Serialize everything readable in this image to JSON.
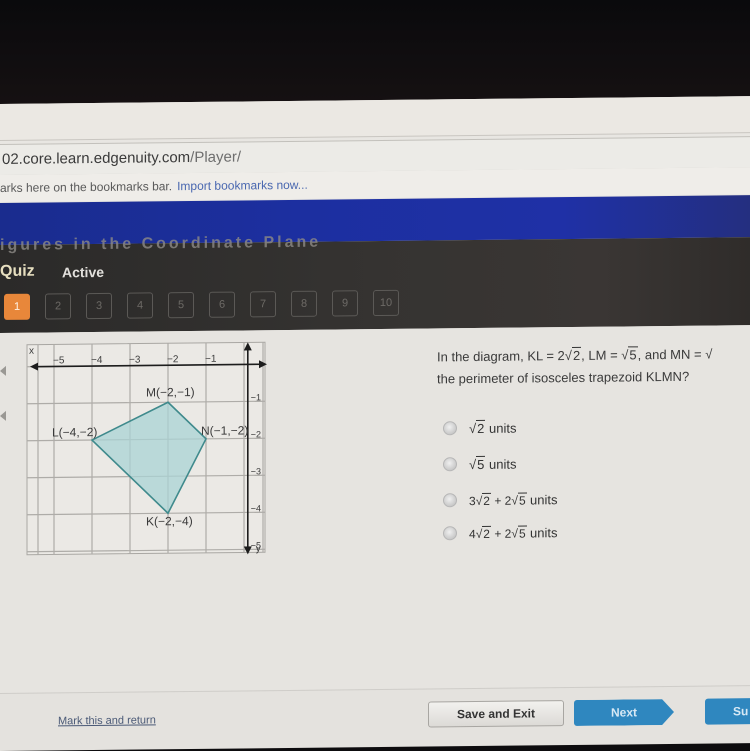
{
  "browser": {
    "address": "02.core.learn.edgenuity.com",
    "address_path": "/Player/",
    "bookmarks_text": "arks here on the bookmarks bar.",
    "bookmarks_link": "Import bookmarks now..."
  },
  "quiz": {
    "partial_title": "igures in the Coordinate Plane",
    "label": "Quiz",
    "status": "Active",
    "questions": [
      "1",
      "2",
      "3",
      "4",
      "5",
      "6",
      "7",
      "8",
      "9",
      "10"
    ],
    "active_question": "1",
    "accent_color": "#e8873a"
  },
  "graph": {
    "x_axis_label": "x",
    "y_axis_label": "y",
    "x_ticks": [
      "-5",
      "-4",
      "-3",
      "-2",
      "-1"
    ],
    "y_ticks": [
      "-1",
      "-2",
      "-3",
      "-4",
      "-5"
    ],
    "points": [
      {
        "label": "M(-2,-1)",
        "x": -2,
        "y": -1
      },
      {
        "label": "L(-4,-2)",
        "x": -4,
        "y": -2
      },
      {
        "label": "N(-1,-2)",
        "x": -1,
        "y": -2
      },
      {
        "label": "K(-2,-4)",
        "x": -2,
        "y": -4
      }
    ],
    "fill_color": "#a9d3d4",
    "stroke_color": "#3f8a8c"
  },
  "question": {
    "line1_prefix": "In the diagram, KL = 2",
    "kl_rad": "2",
    "line1_mid": ", LM = ",
    "lm_rad": "5",
    "line1_suffix": ", and MN = ",
    "line2": "the perimeter of isosceles trapezoid KLMN?",
    "options": [
      {
        "coef1": "",
        "rad1": "2",
        "plus": "",
        "coef2": "",
        "rad2": "",
        "unit": "units"
      },
      {
        "coef1": "",
        "rad1": "5",
        "plus": "",
        "coef2": "",
        "rad2": "",
        "unit": "units"
      },
      {
        "coef1": "3",
        "rad1": "2",
        "plus": "+",
        "coef2": "2",
        "rad2": "5",
        "unit": "units"
      },
      {
        "coef1": "4",
        "rad1": "2",
        "plus": "+",
        "coef2": "2",
        "rad2": "5",
        "unit": "units"
      }
    ]
  },
  "footer": {
    "mark_link": "Mark this and return",
    "save_exit": "Save and Exit",
    "next": "Next",
    "submit": "Su",
    "button_color": "#2f87bf"
  }
}
